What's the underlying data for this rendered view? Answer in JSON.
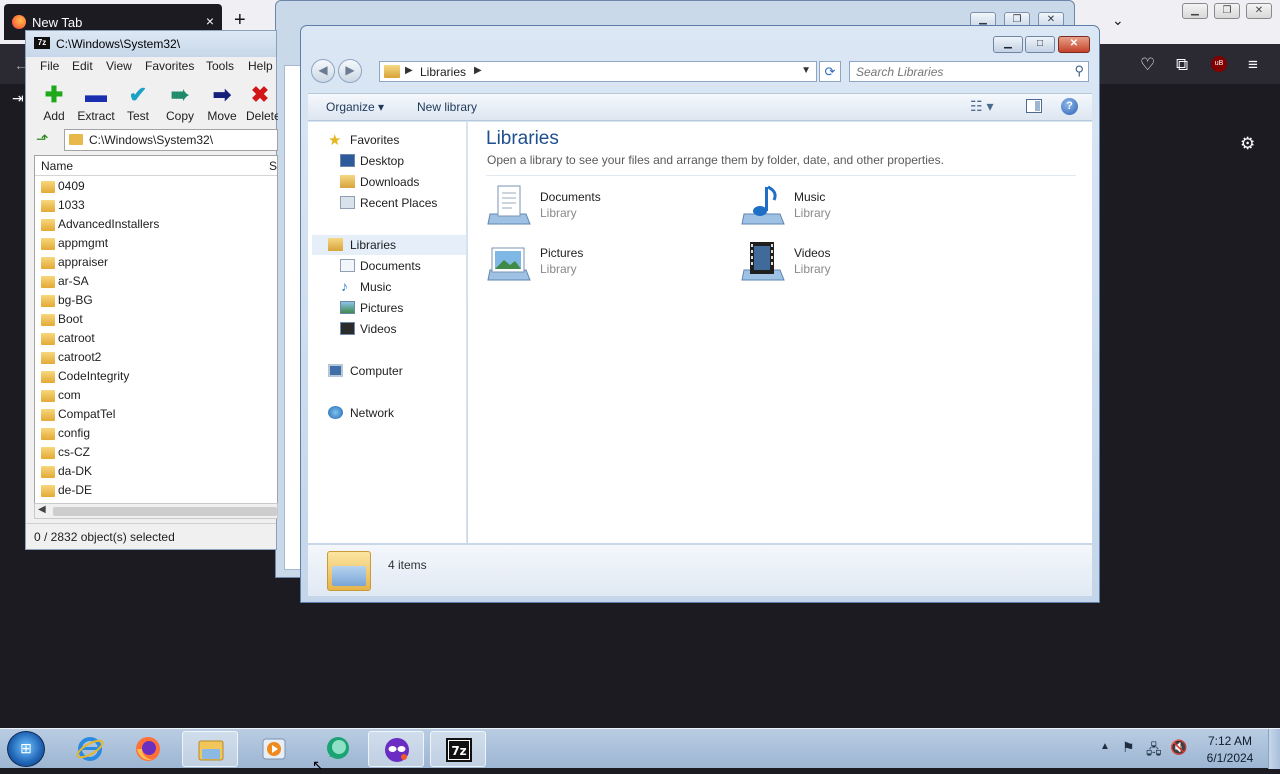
{
  "firefox": {
    "tab_title": "New Tab",
    "tab_close": "×",
    "new_tab": "+",
    "list_tabs": "⌄",
    "ublock_badge": "uB"
  },
  "sevenzip": {
    "title": "C:\\Windows\\System32\\",
    "menu": [
      "File",
      "Edit",
      "View",
      "Favorites",
      "Tools",
      "Help"
    ],
    "toolbar": [
      {
        "label": "Add",
        "icon": "plus-icon",
        "color": "#1fa81a"
      },
      {
        "label": "Extract",
        "icon": "minus-icon",
        "color": "#1a2fb0"
      },
      {
        "label": "Test",
        "icon": "check-icon",
        "color": "#19a2c4"
      },
      {
        "label": "Copy",
        "icon": "double-arrow-icon",
        "color": "#1e8a6c"
      },
      {
        "label": "Move",
        "icon": "arrow-right-icon",
        "color": "#15207a"
      },
      {
        "label": "Delete",
        "icon": "x-icon",
        "color": "#d01616"
      }
    ],
    "path": "C:\\Windows\\System32\\",
    "columns": {
      "name": "Name",
      "size": "S"
    },
    "files": [
      "0409",
      "1033",
      "AdvancedInstallers",
      "appmgmt",
      "appraiser",
      "ar-SA",
      "bg-BG",
      "Boot",
      "catroot",
      "catroot2",
      "CodeIntegrity",
      "com",
      "CompatTel",
      "config",
      "cs-CZ",
      "da-DK",
      "de-DE"
    ],
    "status": "0 / 2832 object(s) selected"
  },
  "explorer": {
    "breadcrumb": "Libraries",
    "search_placeholder": "Search Libraries",
    "commands": {
      "organize": "Organize ▾",
      "new_library": "New library"
    },
    "nav": {
      "favorites": "Favorites",
      "favorites_items": [
        "Desktop",
        "Downloads",
        "Recent Places"
      ],
      "libraries": "Libraries",
      "libraries_items": [
        "Documents",
        "Music",
        "Pictures",
        "Videos"
      ],
      "computer": "Computer",
      "network": "Network"
    },
    "heading": "Libraries",
    "subheading": "Open a library to see your files and arrange them by folder, date, and other properties.",
    "libraries": [
      {
        "name": "Documents",
        "type": "Library",
        "icon": "documents-library-icon"
      },
      {
        "name": "Music",
        "type": "Library",
        "icon": "music-library-icon"
      },
      {
        "name": "Pictures",
        "type": "Library",
        "icon": "pictures-library-icon"
      },
      {
        "name": "Videos",
        "type": "Library",
        "icon": "videos-library-icon"
      }
    ],
    "item_count": "4 items"
  },
  "taskbar": {
    "pinned": [
      "internet-explorer-icon",
      "firefox-icon",
      "windows-explorer-icon",
      "media-player-icon",
      "chat-app-icon",
      "privacy-app-icon",
      "7zip-icon"
    ],
    "time": "7:12 AM",
    "date": "6/1/2024"
  }
}
